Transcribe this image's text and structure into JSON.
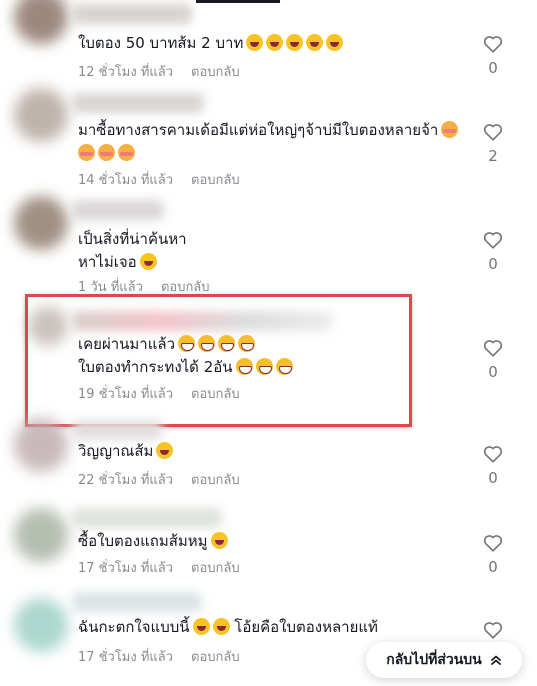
{
  "comments": [
    {
      "text_lines": [
        "ใบตอง 50 บาทส้ม 2 บาท"
      ],
      "emojis": [
        [
          "laugh",
          "laugh",
          "laugh",
          "laugh",
          "laugh"
        ]
      ],
      "time": "12 ชั่วโมง ที่แล้ว",
      "reply_label": "ตอบกลับ",
      "likes": "0"
    },
    {
      "text_lines": [
        "มาซื้อทางสารคามเด้อมีแต่ห่อใหญ่ๆจ้าบ่มีใบตองหลายจ้า",
        ""
      ],
      "emojis": [
        [
          "flush"
        ],
        [
          "flush",
          "flush",
          "flush"
        ]
      ],
      "time": "14 ชั่วโมง ที่แล้ว",
      "reply_label": "ตอบกลับ",
      "likes": "2"
    },
    {
      "text_lines": [
        "เป็นสิ่งที่น่าค้นหา",
        "หาไม่เจอ"
      ],
      "emojis": [
        [],
        [
          "laugh"
        ]
      ],
      "time": "1 วัน ที่แล้ว",
      "reply_label": "ตอบกลับ",
      "likes": "0"
    },
    {
      "text_lines": [
        "เคยผ่านมาแล้ว",
        "ใบตองทำกระทงได้ 2อัน"
      ],
      "emojis": [
        [
          "grin",
          "grin",
          "grin",
          "grin"
        ],
        [
          "grin",
          "grin",
          "grin"
        ]
      ],
      "time": "19 ชั่วโมง ที่แล้ว",
      "reply_label": "ตอบกลับ",
      "likes": "0"
    },
    {
      "text_lines": [
        "วิญญาณส้ม"
      ],
      "emojis": [
        [
          "laugh"
        ]
      ],
      "time": "22 ชั่วโมง ที่แล้ว",
      "reply_label": "ตอบกลับ",
      "likes": "0"
    },
    {
      "text_lines": [
        "ซื้อใบตองแถมส้มหมู"
      ],
      "emojis": [
        [
          "laugh"
        ]
      ],
      "time": "17 ชั่วโมง ที่แล้ว",
      "reply_label": "ตอบกลับ",
      "likes": "0"
    },
    {
      "text_lines": [
        "ฉันกะตกใจแบบนี้",
        " โอ้ยคือใบตองหลายแท้"
      ],
      "emojis": [
        [
          "laugh",
          "laugh"
        ],
        []
      ],
      "time": "17 ชั่วโมง ที่แล้ว",
      "reply_label": "ตอบกลับ",
      "likes": ""
    }
  ],
  "back_to_top": {
    "label": "กลับไปที่ส่วนบน",
    "icon": "double-chevron-up-icon"
  },
  "colors": {
    "highlight": "#e0474c",
    "meta": "#8a8b91",
    "text": "#161823"
  }
}
